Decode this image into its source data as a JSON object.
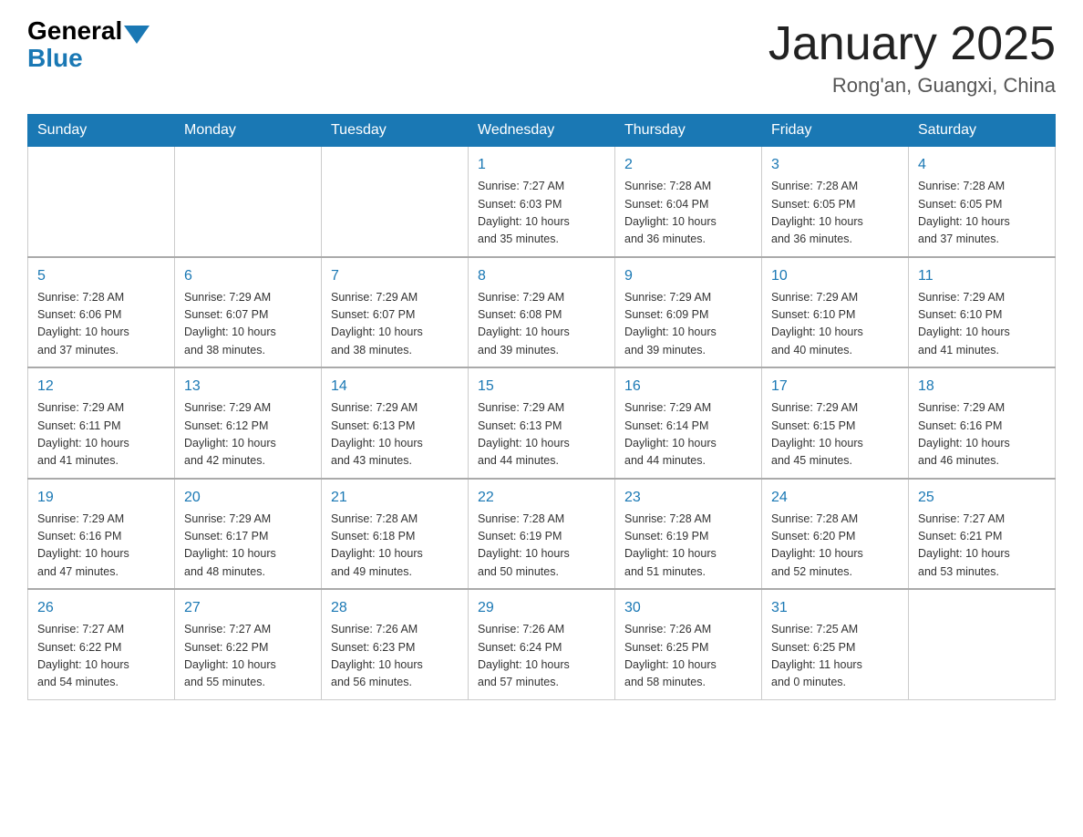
{
  "logo": {
    "general": "General",
    "blue": "Blue"
  },
  "title": "January 2025",
  "subtitle": "Rong'an, Guangxi, China",
  "headers": [
    "Sunday",
    "Monday",
    "Tuesday",
    "Wednesday",
    "Thursday",
    "Friday",
    "Saturday"
  ],
  "weeks": [
    [
      {
        "day": "",
        "info": ""
      },
      {
        "day": "",
        "info": ""
      },
      {
        "day": "",
        "info": ""
      },
      {
        "day": "1",
        "info": "Sunrise: 7:27 AM\nSunset: 6:03 PM\nDaylight: 10 hours\nand 35 minutes."
      },
      {
        "day": "2",
        "info": "Sunrise: 7:28 AM\nSunset: 6:04 PM\nDaylight: 10 hours\nand 36 minutes."
      },
      {
        "day": "3",
        "info": "Sunrise: 7:28 AM\nSunset: 6:05 PM\nDaylight: 10 hours\nand 36 minutes."
      },
      {
        "day": "4",
        "info": "Sunrise: 7:28 AM\nSunset: 6:05 PM\nDaylight: 10 hours\nand 37 minutes."
      }
    ],
    [
      {
        "day": "5",
        "info": "Sunrise: 7:28 AM\nSunset: 6:06 PM\nDaylight: 10 hours\nand 37 minutes."
      },
      {
        "day": "6",
        "info": "Sunrise: 7:29 AM\nSunset: 6:07 PM\nDaylight: 10 hours\nand 38 minutes."
      },
      {
        "day": "7",
        "info": "Sunrise: 7:29 AM\nSunset: 6:07 PM\nDaylight: 10 hours\nand 38 minutes."
      },
      {
        "day": "8",
        "info": "Sunrise: 7:29 AM\nSunset: 6:08 PM\nDaylight: 10 hours\nand 39 minutes."
      },
      {
        "day": "9",
        "info": "Sunrise: 7:29 AM\nSunset: 6:09 PM\nDaylight: 10 hours\nand 39 minutes."
      },
      {
        "day": "10",
        "info": "Sunrise: 7:29 AM\nSunset: 6:10 PM\nDaylight: 10 hours\nand 40 minutes."
      },
      {
        "day": "11",
        "info": "Sunrise: 7:29 AM\nSunset: 6:10 PM\nDaylight: 10 hours\nand 41 minutes."
      }
    ],
    [
      {
        "day": "12",
        "info": "Sunrise: 7:29 AM\nSunset: 6:11 PM\nDaylight: 10 hours\nand 41 minutes."
      },
      {
        "day": "13",
        "info": "Sunrise: 7:29 AM\nSunset: 6:12 PM\nDaylight: 10 hours\nand 42 minutes."
      },
      {
        "day": "14",
        "info": "Sunrise: 7:29 AM\nSunset: 6:13 PM\nDaylight: 10 hours\nand 43 minutes."
      },
      {
        "day": "15",
        "info": "Sunrise: 7:29 AM\nSunset: 6:13 PM\nDaylight: 10 hours\nand 44 minutes."
      },
      {
        "day": "16",
        "info": "Sunrise: 7:29 AM\nSunset: 6:14 PM\nDaylight: 10 hours\nand 44 minutes."
      },
      {
        "day": "17",
        "info": "Sunrise: 7:29 AM\nSunset: 6:15 PM\nDaylight: 10 hours\nand 45 minutes."
      },
      {
        "day": "18",
        "info": "Sunrise: 7:29 AM\nSunset: 6:16 PM\nDaylight: 10 hours\nand 46 minutes."
      }
    ],
    [
      {
        "day": "19",
        "info": "Sunrise: 7:29 AM\nSunset: 6:16 PM\nDaylight: 10 hours\nand 47 minutes."
      },
      {
        "day": "20",
        "info": "Sunrise: 7:29 AM\nSunset: 6:17 PM\nDaylight: 10 hours\nand 48 minutes."
      },
      {
        "day": "21",
        "info": "Sunrise: 7:28 AM\nSunset: 6:18 PM\nDaylight: 10 hours\nand 49 minutes."
      },
      {
        "day": "22",
        "info": "Sunrise: 7:28 AM\nSunset: 6:19 PM\nDaylight: 10 hours\nand 50 minutes."
      },
      {
        "day": "23",
        "info": "Sunrise: 7:28 AM\nSunset: 6:19 PM\nDaylight: 10 hours\nand 51 minutes."
      },
      {
        "day": "24",
        "info": "Sunrise: 7:28 AM\nSunset: 6:20 PM\nDaylight: 10 hours\nand 52 minutes."
      },
      {
        "day": "25",
        "info": "Sunrise: 7:27 AM\nSunset: 6:21 PM\nDaylight: 10 hours\nand 53 minutes."
      }
    ],
    [
      {
        "day": "26",
        "info": "Sunrise: 7:27 AM\nSunset: 6:22 PM\nDaylight: 10 hours\nand 54 minutes."
      },
      {
        "day": "27",
        "info": "Sunrise: 7:27 AM\nSunset: 6:22 PM\nDaylight: 10 hours\nand 55 minutes."
      },
      {
        "day": "28",
        "info": "Sunrise: 7:26 AM\nSunset: 6:23 PM\nDaylight: 10 hours\nand 56 minutes."
      },
      {
        "day": "29",
        "info": "Sunrise: 7:26 AM\nSunset: 6:24 PM\nDaylight: 10 hours\nand 57 minutes."
      },
      {
        "day": "30",
        "info": "Sunrise: 7:26 AM\nSunset: 6:25 PM\nDaylight: 10 hours\nand 58 minutes."
      },
      {
        "day": "31",
        "info": "Sunrise: 7:25 AM\nSunset: 6:25 PM\nDaylight: 11 hours\nand 0 minutes."
      },
      {
        "day": "",
        "info": ""
      }
    ]
  ]
}
